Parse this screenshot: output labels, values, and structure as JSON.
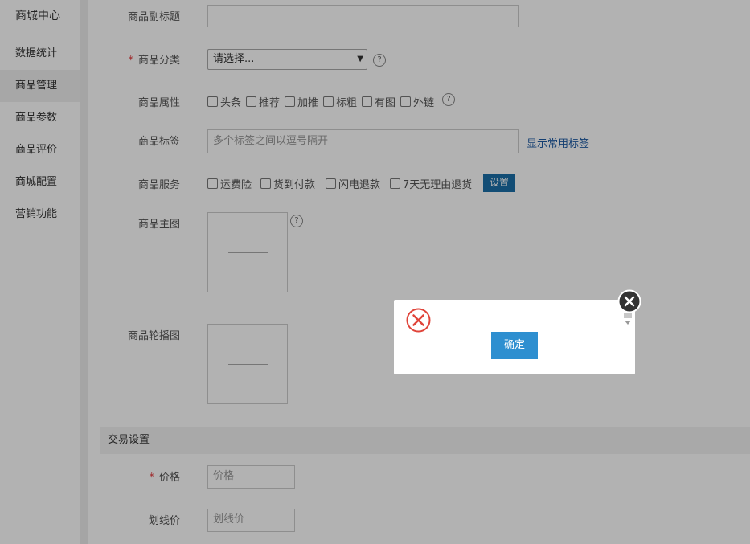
{
  "sidebar": {
    "title": "商城中心",
    "items": [
      {
        "label": "数据统计",
        "active": false
      },
      {
        "label": "商品管理",
        "active": true
      },
      {
        "label": "商品参数",
        "active": false
      },
      {
        "label": "商品评价",
        "active": false
      },
      {
        "label": "商城配置",
        "active": false
      },
      {
        "label": "营销功能",
        "active": false
      }
    ]
  },
  "form": {
    "subtitle": {
      "label": "商品副标题",
      "value": ""
    },
    "category": {
      "required_mark": "*",
      "label": "商品分类",
      "selected": "请选择...",
      "help": "?"
    },
    "attributes": {
      "label": "商品属性",
      "options": [
        "头条",
        "推荐",
        "加推",
        "标粗",
        "有图",
        "外链"
      ],
      "help": "?"
    },
    "tags": {
      "label": "商品标签",
      "placeholder": "多个标签之间以逗号隔开",
      "link": "显示常用标签"
    },
    "services": {
      "label": "商品服务",
      "options": [
        "运费险",
        "货到付款",
        "闪电退款",
        "7天无理由退货"
      ],
      "button": "设置"
    },
    "main_image": {
      "label": "商品主图",
      "help": "?"
    },
    "carousel": {
      "label": "商品轮播图"
    }
  },
  "trade": {
    "section_title": "交易设置",
    "price": {
      "required_mark": "*",
      "label": "价格",
      "placeholder": "价格"
    },
    "strike_price": {
      "label": "划线价",
      "placeholder": "划线价"
    }
  },
  "dialog": {
    "ok_label": "确定"
  },
  "colors": {
    "required": "#e4393c",
    "link": "#1c5aa3",
    "set_button": "#1b6fa8",
    "ok_button": "#2e8fd0",
    "error_icon": "#e0443a"
  }
}
